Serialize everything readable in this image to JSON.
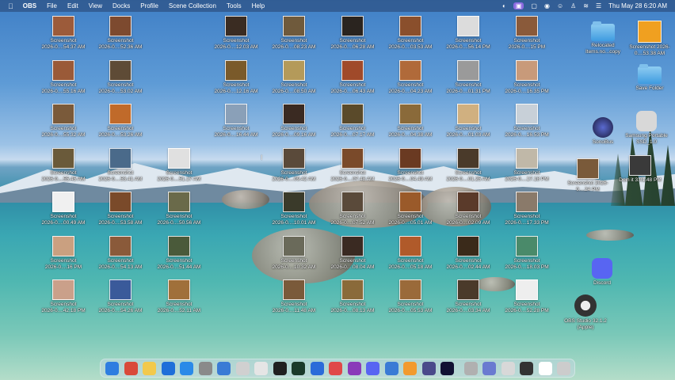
{
  "menubar": {
    "app": "OBS",
    "items": [
      "File",
      "Edit",
      "View",
      "Docks",
      "Profile",
      "Scene Collection",
      "Tools",
      "Help"
    ],
    "clock": "Thu May 28  6:20 AM"
  },
  "icons": [
    {
      "label": "Screenshot",
      "sub": "2026-0....54.37 AM",
      "color": "#9c5b3a"
    },
    {
      "label": "Screenshot",
      "sub": "2026-0....52.36 AM",
      "color": "#7d4a2f"
    },
    {
      "label": "Screenshot",
      "sub": "2026-0....12.03 AM",
      "color": "#3a2c22"
    },
    {
      "label": "Screenshot",
      "sub": "2026-0....08.23 AM",
      "color": "#6f5a3c"
    },
    {
      "label": "Screenshot",
      "sub": "2026-0....06.28 AM",
      "color": "#2a241f"
    },
    {
      "label": "Screenshot",
      "sub": "2026-0....03.53 AM",
      "color": "#8a4f2c"
    },
    {
      "label": "Screenshot",
      "sub": "2026-0....56.14 PM",
      "color": "#dcdcdc"
    },
    {
      "label": "Screenshot",
      "sub": "2026-0....15 PM",
      "color": "#8a5a3a"
    },
    {
      "label": "Screenshot",
      "sub": "2026-0....55.16 AM",
      "color": "#9a5a38"
    },
    {
      "label": "Screenshot",
      "sub": "2026-0....53.02 AM",
      "color": "#5e4b36"
    },
    {
      "label": "Screenshot",
      "sub": "2026-0....12.16 AM",
      "color": "#7a5a2a"
    },
    {
      "label": "Screenshot",
      "sub": "2026-0....08.50 AM",
      "color": "#b49a5a"
    },
    {
      "label": "Screenshot",
      "sub": "2026-0....06.43 AM",
      "color": "#a04a2a"
    },
    {
      "label": "Screenshot",
      "sub": "2026-0....04.23 AM",
      "color": "#b06a3a"
    },
    {
      "label": "Screenshot",
      "sub": "2026-0....01.31 PM",
      "color": "#9a9a9a"
    },
    {
      "label": "Screenshot",
      "sub": "2026-0....16.35 PM",
      "color": "#c89a7a"
    },
    {
      "label": "Screenshot",
      "sub": "2026-0....55.32 AM",
      "color": "#7a5a3a"
    },
    {
      "label": "Screenshot",
      "sub": "2026-0....53.26 AM",
      "color": "#c06a2a"
    },
    {
      "label": "Screenshot",
      "sub": "2026-0....16.44 AM",
      "color": "#8aa0b8"
    },
    {
      "label": "Screenshot",
      "sub": "2026-0....09.16 AM",
      "color": "#3a2a22"
    },
    {
      "label": "Screenshot",
      "sub": "2026-0....07.17 AM",
      "color": "#5a4a2a"
    },
    {
      "label": "Screenshot",
      "sub": "2026-0....04.38 AM",
      "color": "#8a6a3a"
    },
    {
      "label": "Screenshot",
      "sub": "2026-0....01.03 AM",
      "color": "#d0b080"
    },
    {
      "label": "Screenshot",
      "sub": "2026-0....16.53 PM",
      "color": "#c8d0d8"
    },
    {
      "label": "Screenshot",
      "sub": "2026-0....55.45 AM",
      "color": "#6a5a3a"
    },
    {
      "label": "Screenshot",
      "sub": "2026-0....53.41 AM",
      "color": "#4a6a8a"
    },
    {
      "label": "Screenshot",
      "sub": "2026-0....51.17 AM",
      "color": "#e0e0e0"
    },
    {
      "label": "Screenshot",
      "sub": "2026-0....09.42 AM",
      "color": "#5a4a3a"
    },
    {
      "label": "Screenshot",
      "sub": "2026-0....07.48 AM",
      "color": "#7a4a2a"
    },
    {
      "label": "Screenshot",
      "sub": "2026-0....04.49 AM",
      "color": "#6a3a22"
    },
    {
      "label": "Screenshot",
      "sub": "2026-0....01.25 AM",
      "color": "#4a3a2a"
    },
    {
      "label": "Screenshot",
      "sub": "2026-0....17.18 PM",
      "color": "#c0b8a8"
    },
    {
      "label": "Screenshot",
      "sub": "2026-0....00.49 AM",
      "color": "#f0f0f0"
    },
    {
      "label": "Screenshot",
      "sub": "2026-0....53.58 AM",
      "color": "#7a4a2a"
    },
    {
      "label": "Screenshot",
      "sub": "2026-0....50.56 AM",
      "color": "#6a6a4a"
    },
    {
      "label": "Screenshot",
      "sub": "2026-0....10.01 AM",
      "color": "#3a3a2a"
    },
    {
      "label": "Screenshot",
      "sub": "2026-0....07.52 AM",
      "color": "#5a4a3a"
    },
    {
      "label": "Screenshot",
      "sub": "2026-0....05.01 AM",
      "color": "#9a5a2a"
    },
    {
      "label": "Screenshot",
      "sub": "2026-0....02.09 AM",
      "color": "#5a3a2a"
    },
    {
      "label": "Screenshot",
      "sub": "2026-0....17.33 PM",
      "color": "#8a7a6a"
    },
    {
      "label": "Screenshot",
      "sub": "2026-0....16 PM",
      "color": "#caa080"
    },
    {
      "label": "Screenshot",
      "sub": "2026-0....54.13 AM",
      "color": "#8a5a3a"
    },
    {
      "label": "Screenshot",
      "sub": "2026-0....51.44 AM",
      "color": "#4a5a3a"
    },
    {
      "label": "Screenshot",
      "sub": "2026-0....10.32 AM",
      "color": "#6a6a5a"
    },
    {
      "label": "Screenshot",
      "sub": "2026-0....08.04 AM",
      "color": "#3a2a22"
    },
    {
      "label": "Screenshot",
      "sub": "2026-0....05.18 AM",
      "color": "#b05a2a"
    },
    {
      "label": "Screenshot",
      "sub": "2026-0....02.44 AM",
      "color": "#3a2a1a"
    },
    {
      "label": "Screenshot",
      "sub": "2026-0....18.03 PM",
      "color": "#4a8a6a"
    },
    {
      "label": "Screenshot",
      "sub": "2026-0....42.18 PM",
      "color": "#caa08a"
    },
    {
      "label": "Screenshot",
      "sub": "2026-0....54.26 AM",
      "color": "#3a5a9a"
    },
    {
      "label": "Screenshot",
      "sub": "2026-0....52.11 AM",
      "color": "#a0703a"
    },
    {
      "label": "Screenshot",
      "sub": "2026-0....11.48 AM",
      "color": "#7a5a3a"
    },
    {
      "label": "Screenshot",
      "sub": "2026-0....08.13 AM",
      "color": "#8a6a3a"
    },
    {
      "label": "Screenshot",
      "sub": "2026-0....05.53 AM",
      "color": "#9a6a3a"
    },
    {
      "label": "Screenshot",
      "sub": "2026-0....03.34 AM",
      "color": "#4a3a2a"
    },
    {
      "label": "Screenshot",
      "sub": "2026-0....52.28 PM",
      "color": "#eeeeee"
    }
  ],
  "side": {
    "relocated": "Relocated Items.no...copy",
    "screenshot_top": "Screenshot 2026-0....53.38 AM",
    "save_folder": "Save Folder",
    "sonobus": "SonoBus",
    "samsung": "Samsung Portable SSD_1.0",
    "screenshot_right": "Screenshot 2026-0....24 PM",
    "doin": "Doin it 3.01.48 PM",
    "discord": "Discord",
    "obs": "OBS Studio 32.1.2 (Apple)"
  },
  "dock_colors": [
    "#2e7de0",
    "#d94a3a",
    "#f2c94c",
    "#1e6fd9",
    "#2a8ae8",
    "#8a8a8a",
    "#3a7bd5",
    "#d0d0d0",
    "#e5e5e5",
    "#202020",
    "#1a3a2a",
    "#2b6bd9",
    "#e04848",
    "#8a3ab9",
    "#5865f2",
    "#3a7bd5",
    "#f29a2e",
    "#4a4a8a",
    "#111133",
    "#b0b0b0",
    "#6a7ad0",
    "#d8d8d8",
    "#333333",
    "#ffffff",
    "#cccccc"
  ]
}
